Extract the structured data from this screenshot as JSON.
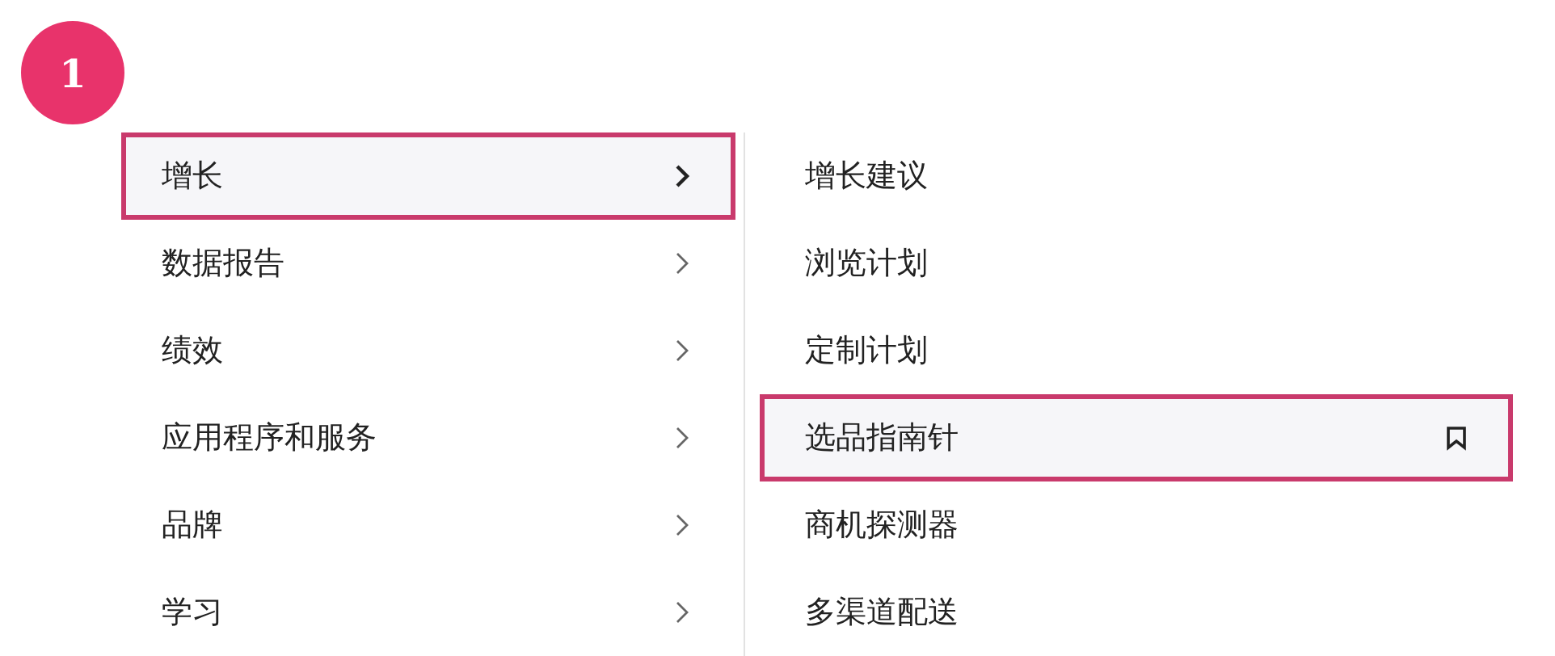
{
  "badge": "1",
  "menu": {
    "items": [
      {
        "label": "增长",
        "selected": true
      },
      {
        "label": "数据报告",
        "selected": false
      },
      {
        "label": "绩效",
        "selected": false
      },
      {
        "label": "应用程序和服务",
        "selected": false
      },
      {
        "label": "品牌",
        "selected": false
      },
      {
        "label": "学习",
        "selected": false
      }
    ]
  },
  "submenu": {
    "items": [
      {
        "label": "增长建议",
        "selected": false
      },
      {
        "label": "浏览计划",
        "selected": false
      },
      {
        "label": "定制计划",
        "selected": false
      },
      {
        "label": "选品指南针",
        "selected": true
      },
      {
        "label": "商机探测器",
        "selected": false
      },
      {
        "label": "多渠道配送",
        "selected": false
      }
    ]
  }
}
